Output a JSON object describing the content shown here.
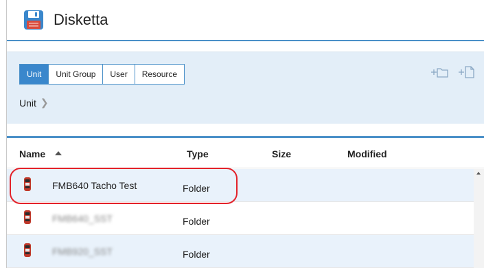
{
  "app": {
    "title": "Disketta",
    "icon": "floppy-disk-icon"
  },
  "toolbar": {
    "tabs": [
      {
        "label": "Unit",
        "active": true
      },
      {
        "label": "Unit Group",
        "active": false
      },
      {
        "label": "User",
        "active": false
      },
      {
        "label": "Resource",
        "active": false
      }
    ],
    "actions": [
      {
        "icon": "add-folder-icon"
      },
      {
        "icon": "add-file-icon"
      }
    ]
  },
  "breadcrumb": {
    "items": [
      "Unit"
    ],
    "separator_icon": "chevron-right-icon"
  },
  "table": {
    "columns": [
      {
        "label": "Name",
        "sort": "ascending"
      },
      {
        "label": "Type"
      },
      {
        "label": "Size"
      },
      {
        "label": "Modified"
      }
    ],
    "rows": [
      {
        "name": "FMB640 Tacho Test",
        "type": "Folder",
        "size": "",
        "modified": "",
        "icon": "vehicle-icon",
        "highlighted": true
      },
      {
        "name": "FMB640_SST",
        "type": "Folder",
        "size": "",
        "modified": "",
        "icon": "vehicle-icon",
        "redacted": true
      },
      {
        "name": "FMB920_SST",
        "type": "Folder",
        "size": "",
        "modified": "",
        "icon": "vehicle-icon",
        "redacted": true
      }
    ]
  },
  "colors": {
    "accent": "#3a87cc",
    "panel_bg": "#e3eef8",
    "row_alt_bg": "#e9f2fb",
    "annotation": "#e3222a"
  }
}
